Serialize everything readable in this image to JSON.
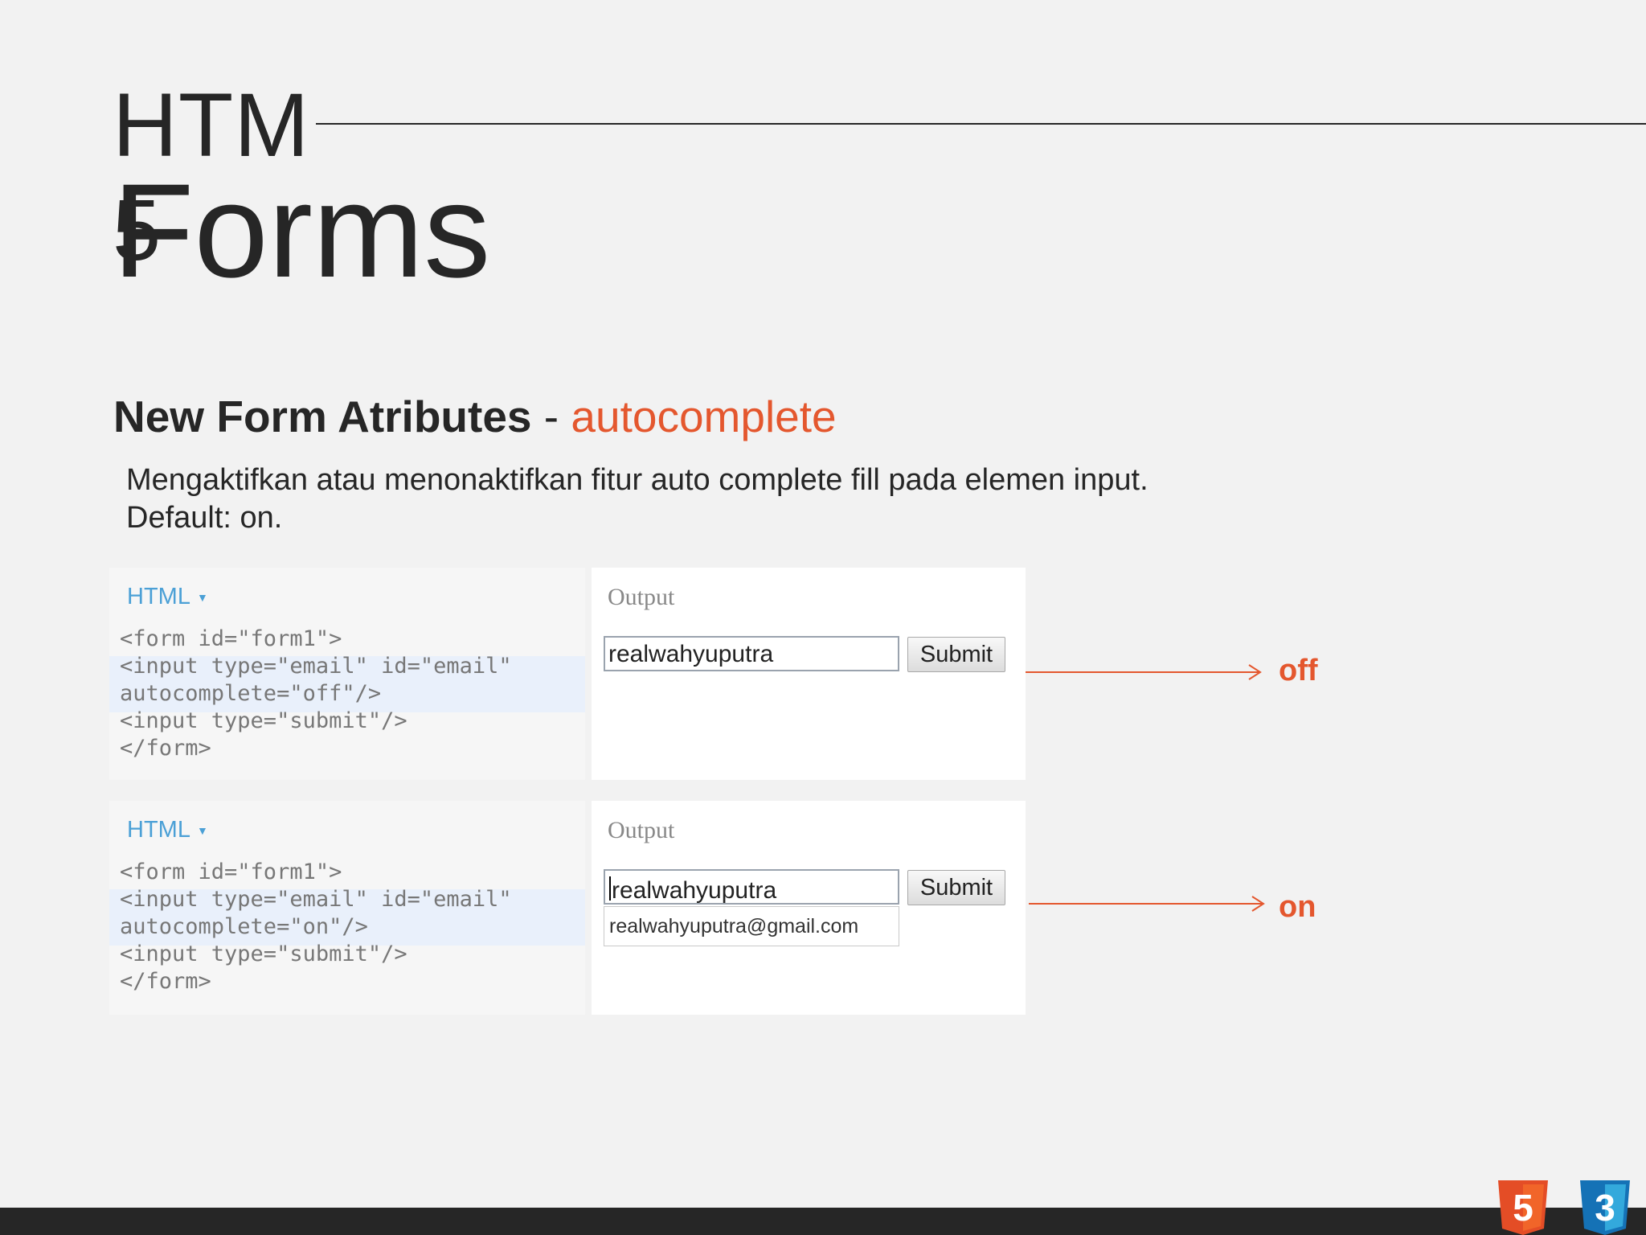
{
  "title": {
    "line1": "HTM",
    "line2_digit": "5",
    "line2": "Forms"
  },
  "section": {
    "heading_main": "New Form Atributes",
    "heading_sep": "-",
    "heading_accent": "autocomplete"
  },
  "description": [
    "Mengaktifkan atau menonaktifkan fitur auto complete fill pada elemen input.",
    "Default: on."
  ],
  "examples": [
    {
      "lang_tab": "HTML",
      "code": [
        "<form id=\"form1\">",
        "<input type=\"email\" id=\"email\"",
        "autocomplete=\"off\"/>",
        "<input type=\"submit\"/>",
        "</form>"
      ],
      "output_label": "Output",
      "input_value": "realwahyuputra",
      "submit_label": "Submit",
      "result_label": "off"
    },
    {
      "lang_tab": "HTML",
      "code": [
        "<form id=\"form1\">",
        "<input type=\"email\" id=\"email\"",
        "autocomplete=\"on\"/>",
        "<input type=\"submit\"/>",
        "</form>"
      ],
      "output_label": "Output",
      "input_value": "realwahyuputra",
      "submit_label": "Submit",
      "suggestion": "realwahyuputra@gmail.com",
      "result_label": "on"
    }
  ],
  "logos": {
    "html5": "5",
    "css3": "3"
  },
  "colors": {
    "accent": "#e4572e",
    "html5": "#e44d26",
    "css3": "#1572b6",
    "footer": "#262626"
  }
}
